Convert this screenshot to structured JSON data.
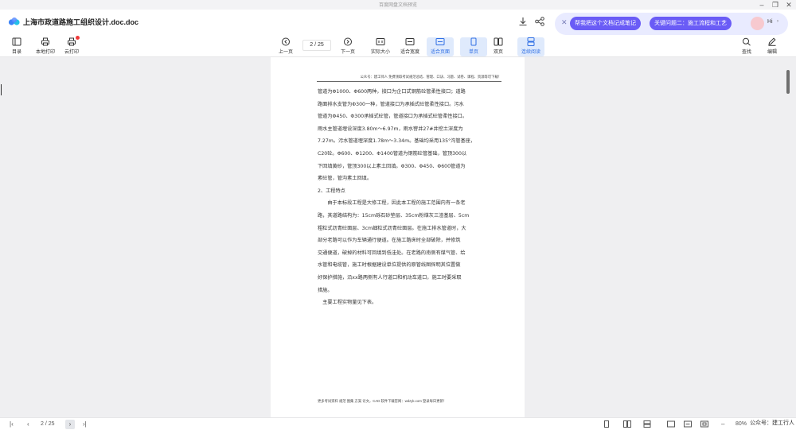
{
  "app": {
    "window_title": "百度网盘文档预览"
  },
  "header": {
    "doc_title": "上海市政道路施工组织设计.doc.doc",
    "ai": {
      "chip1": "帮我把这个文档记成笔记",
      "chip2": "关键问题二：施工流程和工艺",
      "greeting": "Hi"
    }
  },
  "toolbar": {
    "left": [
      {
        "label": "目录",
        "icon": "toc-icon"
      },
      {
        "label": "本地打印",
        "icon": "printer-icon"
      },
      {
        "label": "云打印",
        "icon": "cloud-print-icon"
      }
    ],
    "prev_label": "上一页",
    "page_indicator": "2 / 25",
    "next_label": "下一页",
    "center": [
      {
        "label": "实际大小",
        "icon": "actual-size-icon"
      },
      {
        "label": "适合宽度",
        "icon": "fit-width-icon"
      },
      {
        "label": "适合页面",
        "icon": "fit-page-icon",
        "active": true
      }
    ],
    "views": [
      {
        "label": "单页",
        "icon": "single-page-icon",
        "active": true
      },
      {
        "label": "双页",
        "icon": "double-page-icon"
      },
      {
        "label": "连续阅读",
        "icon": "continuous-read-icon",
        "active": true
      }
    ],
    "right": [
      {
        "label": "查找",
        "icon": "search-icon"
      },
      {
        "label": "编辑",
        "icon": "edit-icon"
      }
    ]
  },
  "document": {
    "header_line": "公众号：建工师人 免费领取考试规范总结、管理、口诀、习题、试卷、课程、资源等可下载！",
    "lines": [
      "管道为Φ1000、Φ600两种，接口为企口式钢筋砼管柔性接口；道路",
      "路面排水支管为Φ300一种，管道接口为承插式砼管柔性接口。污水",
      "管道为Φ450、Φ300承插式砼管，管道接口为承插式砼管柔性接口。",
      "雨水主管道埋设深度3.80m～6.97m，雨水窨井27#井挖土深度为",
      "7.27m。污水管道埋深度1.78m～3.34m。基础均采用135°沟管基座，",
      "C20砼。Φ600、Φ1200、Φ1400管道为钢筋砼管基础，管顶300以",
      "下回填黄砂，管顶300以上素土回填。Φ300、Φ450、Φ600管道为",
      "素砼管，管沟素土回填。",
      "2、工程特点",
      "　　由于本标段工程是大修工程，因此本工程的施工范围内有一条老",
      "路，其道路结构为：15cm砾石砂垫层、35cm粉煤灰三渣基层、5cm",
      "粗粒式沥青砼面层、3cm细粒式沥青砼面层。在施工排水管道时，大",
      "部分老路可以作为车辆通行便道。在施工路床时全部破除，并修筑",
      "交通便道，破掉的材料可回填到低洼处。在老路的南侧有煤气管、给",
      "水管和电缆管，施工时根据建设单位提供的原管线图探明其位置做",
      "好保护措施，沿xx路两侧有人行道口和机动车道口，施工时要采取",
      "措施。",
      "　主要工程实物量见下表。"
    ],
    "footer_line": "更多考试资料 规范 图集 方案 论文，CAD 软件下载官网：wdzyk.com 登录每日更新！"
  },
  "bottom": {
    "page_indicator": "2 / 25",
    "zoom": "80%",
    "watermark": "公众号：建工行人"
  },
  "colors": {
    "accent": "#2f6fe4",
    "ai_chip": "#6a5cf6",
    "ai_panel": "#e9ebff",
    "badge": "#f03a3a"
  }
}
